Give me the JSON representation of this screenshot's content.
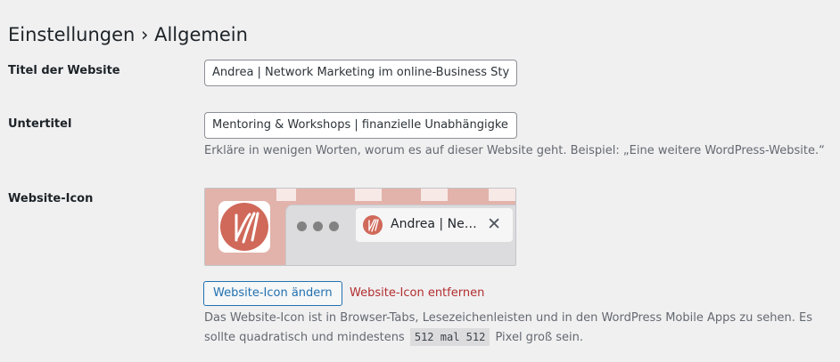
{
  "page": {
    "title": "Einstellungen › Allgemein"
  },
  "site_title": {
    "label": "Titel der Website",
    "value": "Andrea | Network Marketing im online-Business Style"
  },
  "tagline": {
    "label": "Untertitel",
    "value": "Mentoring & Workshops | finanzielle Unabhängigkeit",
    "description": "Erkläre in wenigen Worten, worum es auf dieser Website geht. Beispiel: „Eine weitere WordPress-Website.“"
  },
  "site_icon": {
    "label": "Website-Icon",
    "preview_tab_label": "Andrea | Network Marketing im online-Business Style",
    "close_glyph": "✕",
    "change_button": "Website-Icon ändern",
    "remove_link": "Website-Icon entfernen",
    "description_before": "Das Website-Icon ist in Browser-Tabs, Lesezeichenleisten und in den WordPress Mobile Apps zu sehen. Es sollte quadratisch und mindestens",
    "size_code": "512 mal 512",
    "description_after": "Pixel groß sein.",
    "icon_color": "#d0695a",
    "icon_name": "site-logo-icon"
  },
  "colors": {
    "background": "#f0f0f1",
    "accent": "#2271b1",
    "danger": "#b32d2e",
    "preview_bg": "#e2b3ab"
  }
}
